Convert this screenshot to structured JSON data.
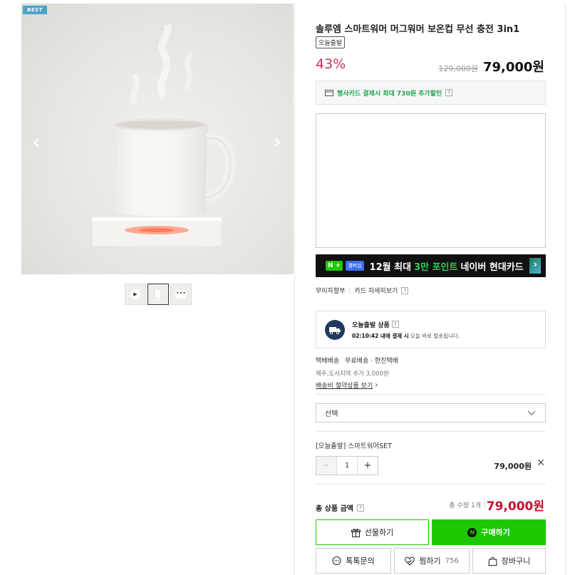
{
  "gallery": {
    "badge": "BEST",
    "prev_arrow": "‹",
    "next_arrow": "›",
    "thumbnails": [
      "video-thumb",
      "mug-thumb",
      "more-thumb"
    ]
  },
  "product": {
    "title": "솔루엠 스마트워머 머그워머 보온컵 무선 충전 3in1",
    "tag": "오늘출발",
    "discount": "43%",
    "original_price": "129,000원",
    "sale_price": "79,000원",
    "card_benefit": "행사카드 결제시 최대 730원 추가할인",
    "help_mark": "?"
  },
  "naver_banner": {
    "n_badge": "N +",
    "shop_badge": "멤버십",
    "text_prefix": "12월 최대 ",
    "text_highlight": "3만 포인트",
    "text_suffix": " 네이버 현대카드",
    "chevron": "›"
  },
  "sub_links": {
    "installment": "무이자할부",
    "card_detail": "카드 자세히보기"
  },
  "delivery": {
    "title": "오늘출발 상품",
    "deadline": "02:10:42 내에 결제 시",
    "deadline_suffix": " 오늘 바로 발송됩니다.",
    "method": "택배배송",
    "fee": "무료배송 · 한진택배",
    "extra": "제주,도서지역 추가 3,000원",
    "save_link": "배송비 절약상품 보기"
  },
  "option": {
    "select_placeholder": "선택",
    "selected_name": "[오늘출발] 스마트워머SET",
    "quantity": "1",
    "minus": "−",
    "plus": "+",
    "price": "79,000원",
    "remove": "✕"
  },
  "total": {
    "label": "총 상품 금액",
    "count": "총 수량 1개",
    "price": "79,000원"
  },
  "buttons": {
    "gift": "선물하기",
    "buy": "구매하기",
    "talk": "톡톡문의",
    "like": "찜하기",
    "like_count": "756",
    "cart": "장바구니"
  },
  "colors": {
    "naver_green": "#1ec800",
    "discount": "#c8325a",
    "total_price": "#c8102e"
  }
}
